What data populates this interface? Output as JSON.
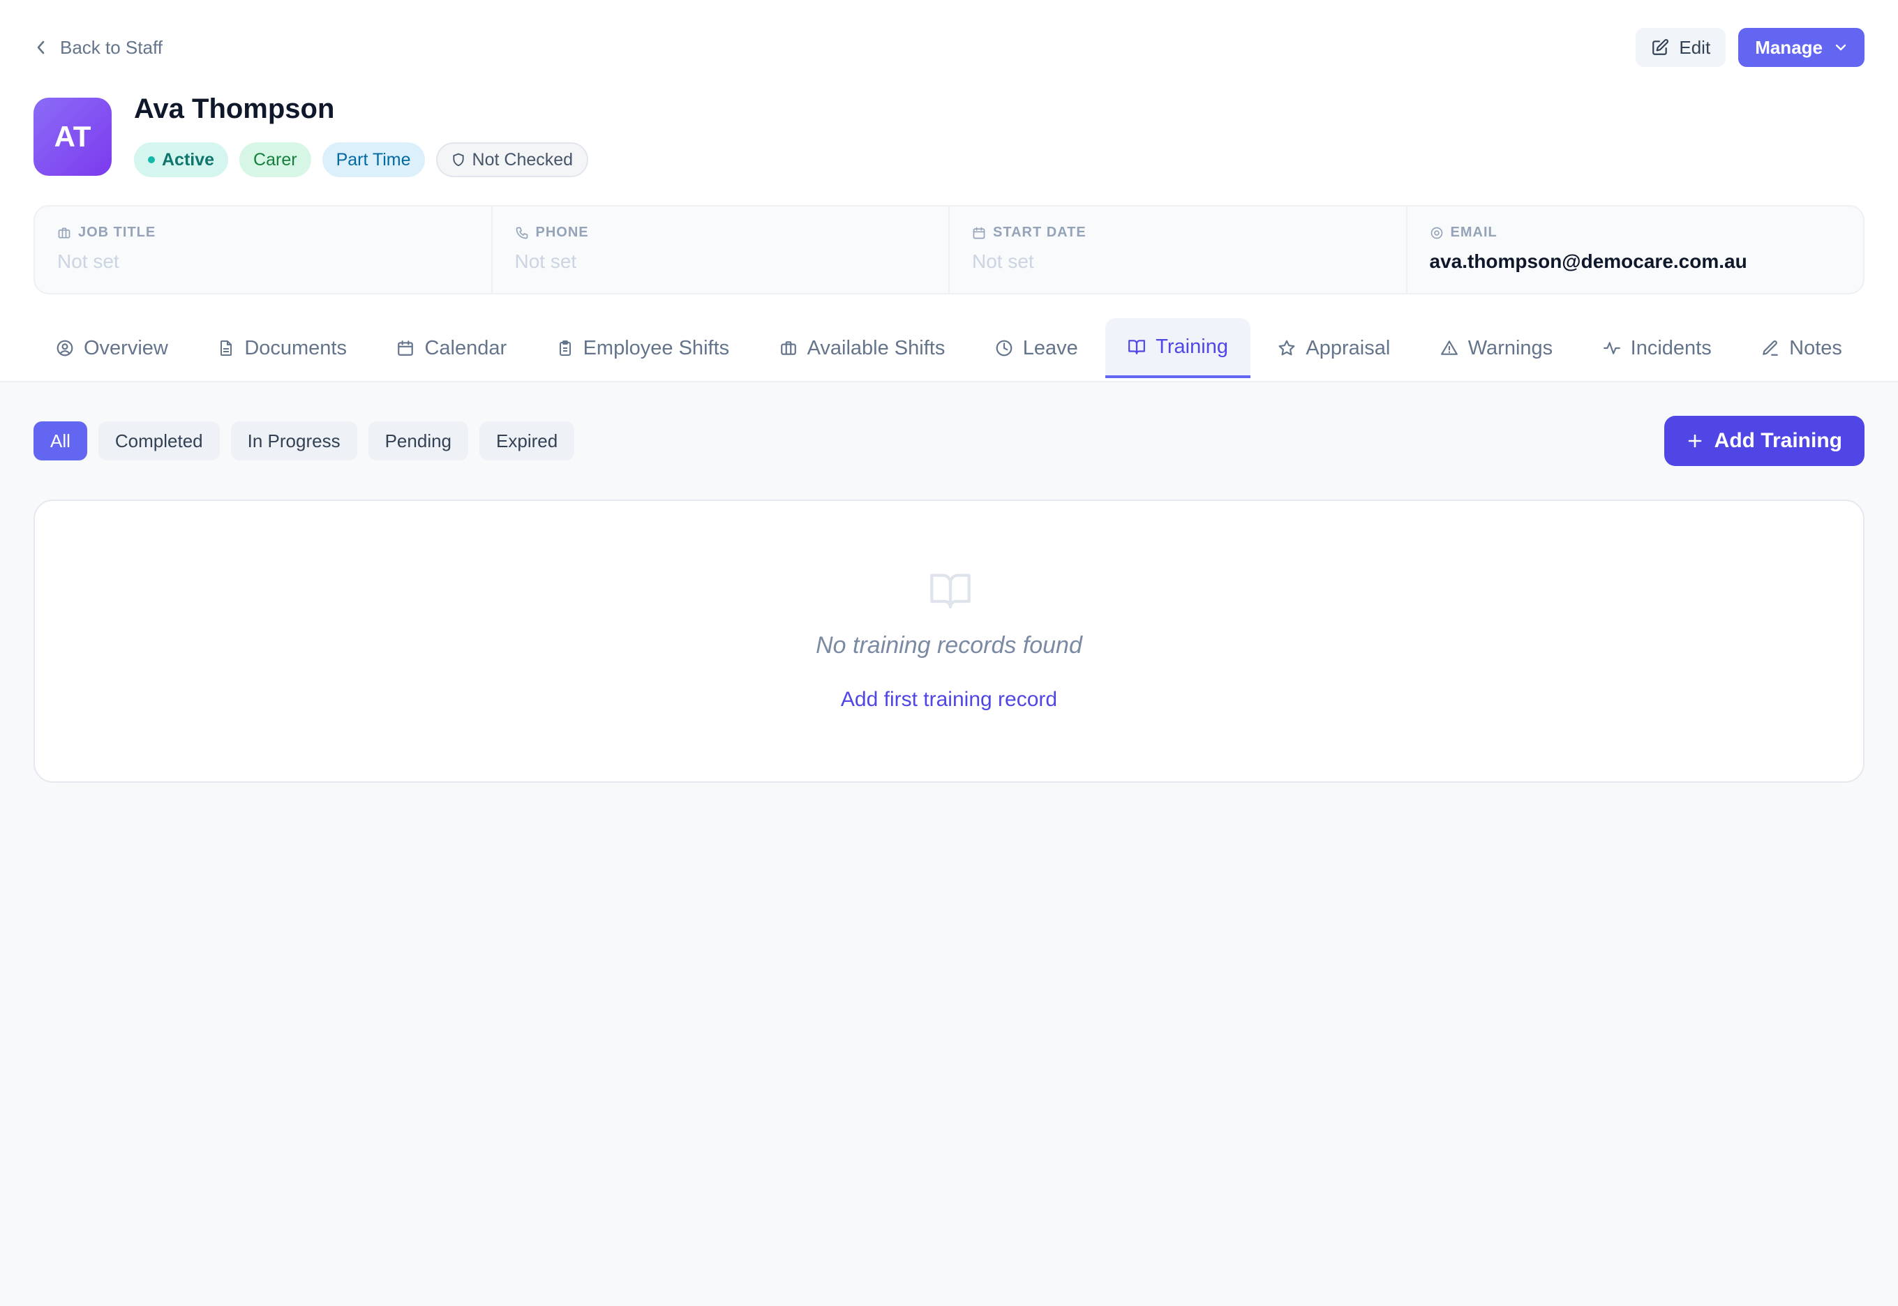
{
  "header": {
    "back_label": "Back to Staff",
    "edit_label": "Edit",
    "manage_label": "Manage"
  },
  "profile": {
    "initials": "AT",
    "name": "Ava Thompson",
    "badges": {
      "status": "Active",
      "role": "Carer",
      "employment": "Part Time",
      "check": "Not Checked"
    }
  },
  "info": [
    {
      "label": "JOB TITLE",
      "value": "Not set",
      "icon": "briefcase-icon"
    },
    {
      "label": "PHONE",
      "value": "Not set",
      "icon": "phone-icon"
    },
    {
      "label": "START DATE",
      "value": "Not set",
      "icon": "calendar-icon"
    },
    {
      "label": "EMAIL",
      "value": "ava.thompson@democare.com.au",
      "icon": "at-sign-icon"
    }
  ],
  "tabs": [
    {
      "label": "Overview",
      "icon": "user-circle-icon"
    },
    {
      "label": "Documents",
      "icon": "file-icon"
    },
    {
      "label": "Calendar",
      "icon": "calendar-icon"
    },
    {
      "label": "Employee Shifts",
      "icon": "clipboard-icon"
    },
    {
      "label": "Available Shifts",
      "icon": "briefcase-icon"
    },
    {
      "label": "Leave",
      "icon": "clock-icon"
    },
    {
      "label": "Training",
      "icon": "book-open-icon",
      "active": true
    },
    {
      "label": "Appraisal",
      "icon": "star-icon"
    },
    {
      "label": "Warnings",
      "icon": "warning-triangle-icon"
    },
    {
      "label": "Incidents",
      "icon": "activity-icon"
    },
    {
      "label": "Notes",
      "icon": "pencil-icon"
    }
  ],
  "filters": [
    {
      "label": "All",
      "active": true
    },
    {
      "label": "Completed"
    },
    {
      "label": "In Progress"
    },
    {
      "label": "Pending"
    },
    {
      "label": "Expired"
    }
  ],
  "add_training_label": "Add Training",
  "empty_state": {
    "icon": "book-open-icon",
    "message": "No training records found",
    "link": "Add first training record"
  },
  "colors": {
    "accent": "#6366f1",
    "accent_dark": "#4f46e5",
    "active_badge": "#14b8a6"
  }
}
